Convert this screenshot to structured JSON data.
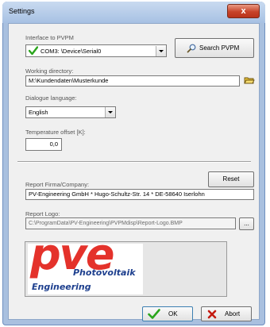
{
  "window": {
    "title": "Settings",
    "close_glyph": "x"
  },
  "interface": {
    "label": "Interface to PVPM",
    "value": "COM3: \\Device\\Serial0",
    "status_icon": "green-check-icon",
    "search_button": "Search PVPM"
  },
  "working_dir": {
    "label": "Working directory:",
    "value": "M:\\Kundendaten\\Musterkunde"
  },
  "language": {
    "label": "Dialogue language:",
    "value": "English"
  },
  "temp_offset": {
    "label": "Temperature offset [K]:",
    "value": "0,0"
  },
  "report": {
    "company_label": "Report Firma/Company:",
    "reset_button": "Reset",
    "company_value": "PV-Engineering GmbH * Hugo-Schultz-Str. 14 * DE-58640 Iserlohn",
    "logo_label": "Report Logo:",
    "logo_path": "C:\\ProgramData\\PV-Engineering\\PVPMdisp\\Report-Logo.BMP",
    "browse_button": "..."
  },
  "logo": {
    "big_text": "pve",
    "line1": "Photovoltaik",
    "line2": "Engineering"
  },
  "footer": {
    "ok_button": "OK",
    "abort_button": "Abort"
  },
  "colors": {
    "check_green": "#2aa51c",
    "abort_red": "#c41a10",
    "logo_red": "#e4322b",
    "logo_blue": "#1d3f8e"
  }
}
